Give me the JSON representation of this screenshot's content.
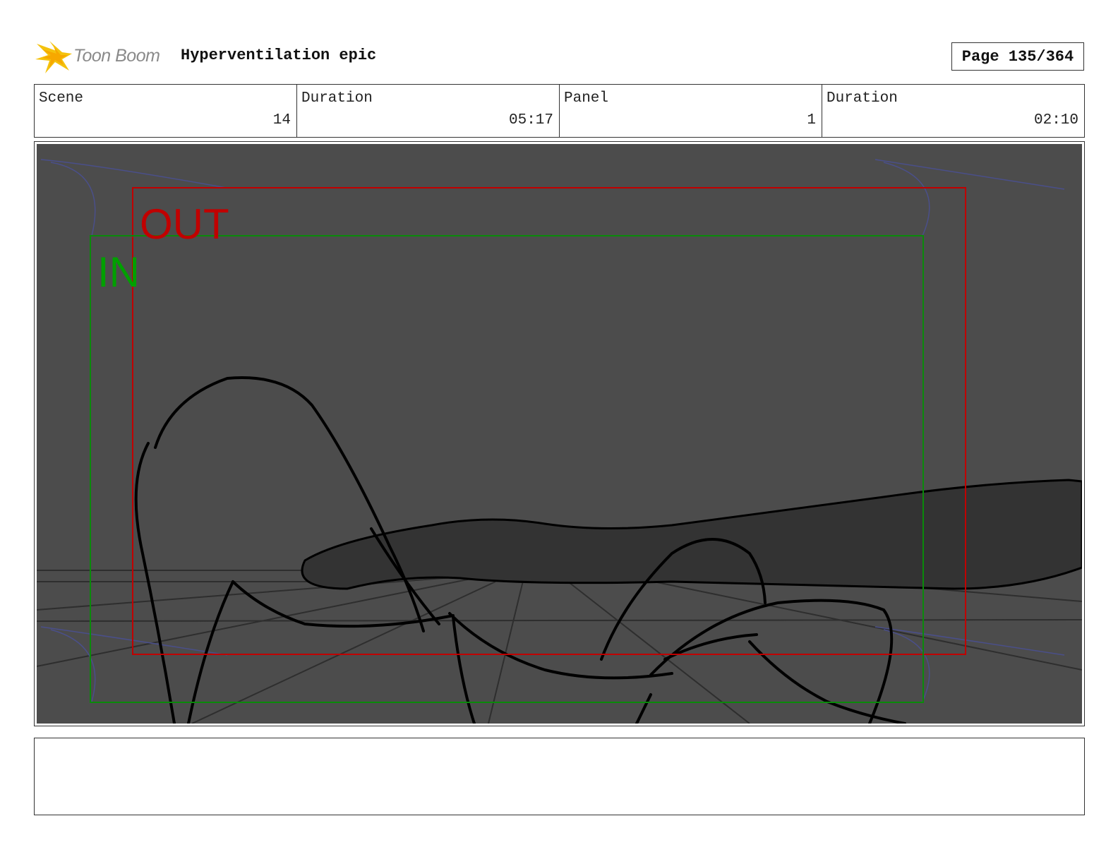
{
  "header": {
    "logo_text": "Toon Boom",
    "title": "Hyperventilation epic",
    "page_indicator": "Page 135/364"
  },
  "info": {
    "scene_label": "Scene",
    "scene_value": "14",
    "scene_duration_label": "Duration",
    "scene_duration_value": "05:17",
    "panel_label": "Panel",
    "panel_value": "1",
    "panel_duration_label": "Duration",
    "panel_duration_value": "02:10"
  },
  "frame_labels": {
    "out_label": "OUT",
    "in_label": "IN",
    "out_color": "#c00000",
    "in_color": "#00a000"
  },
  "notes": {
    "text": ""
  }
}
